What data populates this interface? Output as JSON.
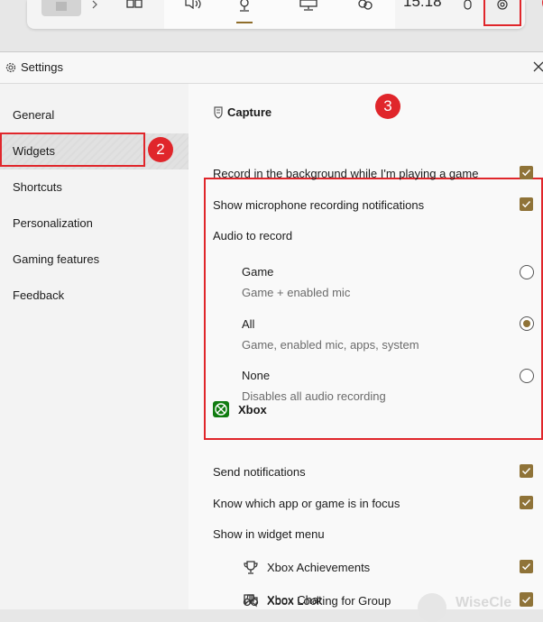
{
  "gamebar": {
    "time": "15:18"
  },
  "window": {
    "title": "Settings"
  },
  "sidebar": {
    "items": [
      {
        "label": "General"
      },
      {
        "label": "Widgets"
      },
      {
        "label": "Shortcuts"
      },
      {
        "label": "Personalization"
      },
      {
        "label": "Gaming features"
      },
      {
        "label": "Feedback"
      }
    ],
    "active": "Widgets"
  },
  "annotations": {
    "badge2": "2",
    "badge3": "3"
  },
  "capture": {
    "heading": "Capture",
    "record_background": {
      "label": "Record in the background while I'm playing a game",
      "checked": true
    },
    "mic_notifications": {
      "label": "Show microphone recording notifications",
      "checked": true
    },
    "audio_label": "Audio to record",
    "options": [
      {
        "label": "Game",
        "sub": "Game + enabled mic",
        "selected": false
      },
      {
        "label": "All",
        "sub": "Game, enabled mic, apps, system",
        "selected": true
      },
      {
        "label": "None",
        "sub": "Disables all audio recording",
        "selected": false
      }
    ]
  },
  "xbox": {
    "heading": "Xbox",
    "send_notifications": {
      "label": "Send notifications",
      "checked": true
    },
    "know_focus": {
      "label": "Know which app or game is in focus",
      "checked": true
    },
    "widget_menu_label": "Show in widget menu",
    "widget_items": [
      {
        "label": "Xbox Achievements",
        "icon": "trophy-icon",
        "checked": true
      },
      {
        "label": "Xbox Chat",
        "icon": "chat-icon",
        "checked": true
      },
      {
        "label": "Xbox Looking for Group",
        "icon": "binoculars-icon",
        "checked": true
      }
    ]
  },
  "watermark": "WiseCle",
  "colors": {
    "accent": "#8f7338",
    "annotation_red": "#e0262b",
    "xbox_green": "#107c10"
  }
}
